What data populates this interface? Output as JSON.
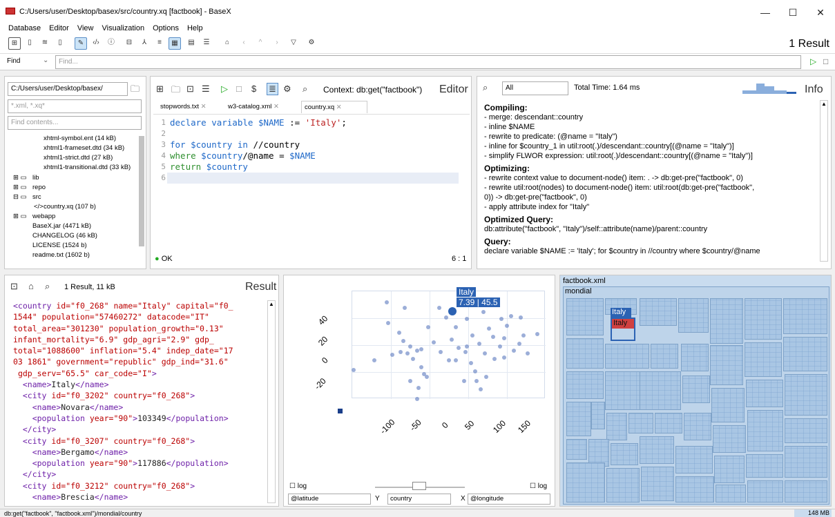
{
  "window": {
    "title": "C:/Users/user/Desktop/basex/src/country.xq [factbook] - BaseX",
    "min": "—",
    "max": "☐",
    "close": "✕"
  },
  "menu": [
    "Database",
    "Editor",
    "View",
    "Visualization",
    "Options",
    "Help"
  ],
  "toolbar": {
    "result_count": "1 Result"
  },
  "find": {
    "mode": "Find",
    "placeholder": "Find..."
  },
  "project": {
    "path": "C:/Users/user/Desktop/basex/",
    "filter_placeholder": "*.xml, *.xq*",
    "contents_placeholder": "Find contents...",
    "files": [
      "xhtml-symbol.ent (14 kB)",
      "xhtml1-frameset.dtd (34 kB)",
      "xhtml1-strict.dtd (27 kB)",
      "xhtml1-transitional.dtd (33 kB)",
      "lib",
      "repo",
      "src",
      "country.xq (107 b)",
      "webapp",
      "BaseX.jar (4471 kB)",
      "CHANGELOG (46 kB)",
      "LICENSE (1524 b)",
      "readme.txt (1602 b)"
    ]
  },
  "editor": {
    "context": "Context: db:get(\"factbook\")",
    "title": "Editor",
    "tabs": [
      "stopwords.txt",
      "w3-catalog.xml",
      "country.xq"
    ],
    "status": "OK",
    "position": "6 : 1",
    "lines": [
      "1",
      "2",
      "3",
      "4",
      "5",
      "6"
    ]
  },
  "info": {
    "mode": "All",
    "total": "Total Time: 1.64 ms",
    "title": "Info",
    "compiling_h": "Compiling:",
    "compiling": [
      "- merge: descendant::country",
      "- inline $NAME",
      "- rewrite to predicate: (@name = \"Italy\")",
      "- inline for $country_1 in util:root(.)/descendant::country[(@name = \"Italy\")]",
      "- simplify FLWOR expression: util:root(.)/descendant::country[(@name = \"Italy\")]"
    ],
    "optimizing_h": "Optimizing:",
    "optimizing": [
      "- rewrite context value to document-node() item: . -> db:get-pre(\"factbook\", 0)",
      "- rewrite util:root(nodes) to document-node() item: util:root(db:get-pre(\"factbook\",",
      "  0)) -> db:get-pre(\"factbook\", 0)",
      "- apply attribute index for \"Italy\""
    ],
    "optq_h": "Optimized Query:",
    "optq": "db:attribute(\"factbook\", \"Italy\")/self::attribute(name)/parent::country",
    "query_h": "Query:",
    "query": "declare variable $NAME := 'Italy'; for $country in //country where $country/@name"
  },
  "result": {
    "summary": "1 Result, 11 kB",
    "title": "Result"
  },
  "scatter": {
    "tooltip_name": "Italy",
    "tooltip_val": "7.39 | 45.5",
    "yticks": [
      "40",
      "20",
      "0",
      "-20"
    ],
    "xticks": [
      "-100",
      "-50",
      "0",
      "50",
      "100",
      "150"
    ],
    "log_label": "log",
    "y_label": "Y",
    "x_label": "X",
    "y_select": "@latitude",
    "item_select": "country",
    "x_select": "@longitude"
  },
  "map": {
    "root": "factbook.xml",
    "sub": "mondial",
    "selected": "Italy"
  },
  "status": {
    "query": "db:get(\"factbook\", \"factbook.xml\")/mondial/country",
    "memory": "148 MB"
  }
}
